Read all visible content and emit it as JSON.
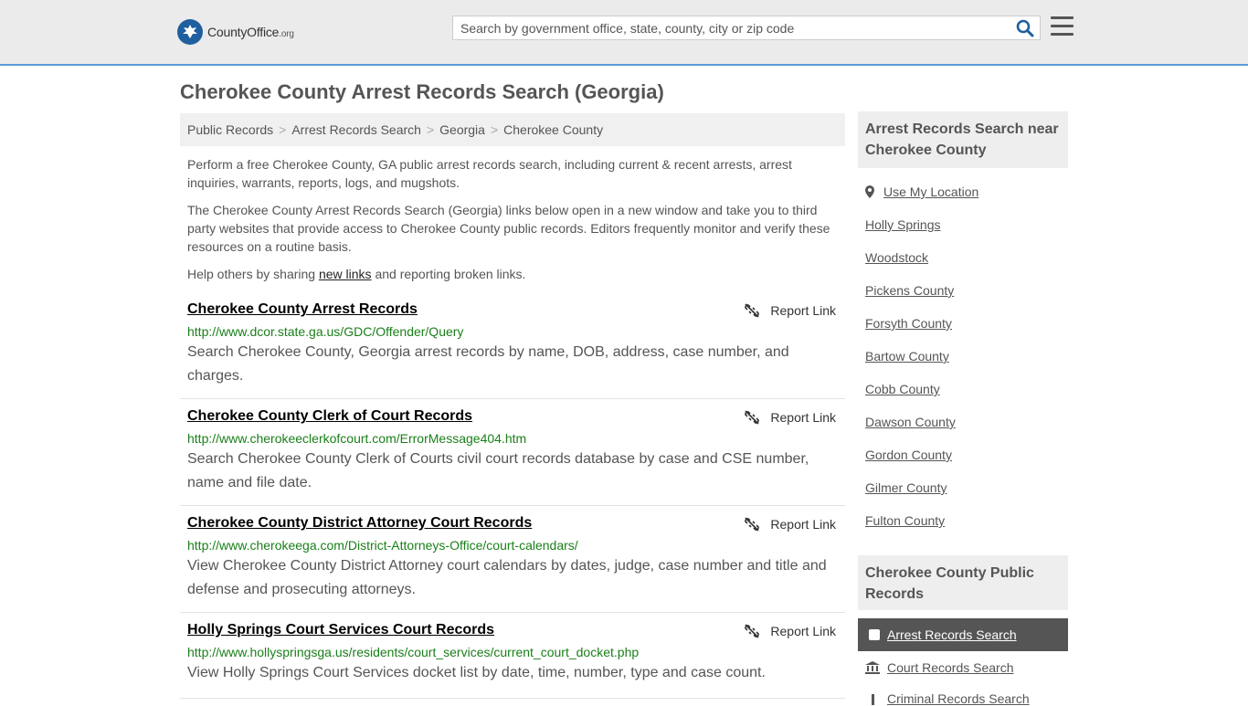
{
  "header": {
    "logo_brand": "CountyOffice",
    "logo_tld": ".org",
    "search_placeholder": "Search by government office, state, county, city or zip code"
  },
  "page_title": "Cherokee County Arrest Records Search (Georgia)",
  "breadcrumb": [
    "Public Records",
    "Arrest Records Search",
    "Georgia",
    "Cherokee County"
  ],
  "intro": {
    "p1": "Perform a free Cherokee County, GA public arrest records search, including current & recent arrests, arrest inquiries, warrants, reports, logs, and mugshots.",
    "p2": "The Cherokee County Arrest Records Search (Georgia) links below open in a new window and take you to third party websites that provide access to Cherokee County public records. Editors frequently monitor and verify these resources on a routine basis.",
    "p3_before": "Help others by sharing ",
    "p3_link": "new links",
    "p3_after": " and reporting broken links."
  },
  "report_label": "Report Link",
  "results": [
    {
      "title": "Cherokee County Arrest Records",
      "url": "http://www.dcor.state.ga.us/GDC/Offender/Query",
      "desc": "Search Cherokee County, Georgia arrest records by name, DOB, address, case number, and charges."
    },
    {
      "title": "Cherokee County Clerk of Court Records",
      "url": "http://www.cherokeeclerkofcourt.com/ErrorMessage404.htm",
      "desc": "Search Cherokee County Clerk of Courts civil court records database by case and CSE number, name and file date."
    },
    {
      "title": "Cherokee County District Attorney Court Records",
      "url": "http://www.cherokeega.com/District-Attorneys-Office/court-calendars/",
      "desc": "View Cherokee County District Attorney court calendars by dates, judge, case number and title and defense and prosecuting attorneys."
    },
    {
      "title": "Holly Springs Court Services Court Records",
      "url": "http://www.hollyspringsga.us/residents/court_services/current_court_docket.php",
      "desc": "View Holly Springs Court Services docket list by date, time, number, type and case count."
    }
  ],
  "sidebar": {
    "nearby_heading": "Arrest Records Search near Cherokee County",
    "use_location": "Use My Location",
    "nearby": [
      "Holly Springs",
      "Woodstock",
      "Pickens County",
      "Forsyth County",
      "Bartow County",
      "Cobb County",
      "Dawson County",
      "Gordon County",
      "Gilmer County",
      "Fulton County"
    ],
    "public_heading": "Cherokee County Public Records",
    "public_items": [
      "Arrest Records Search",
      "Court Records Search",
      "Criminal Records Search"
    ]
  }
}
